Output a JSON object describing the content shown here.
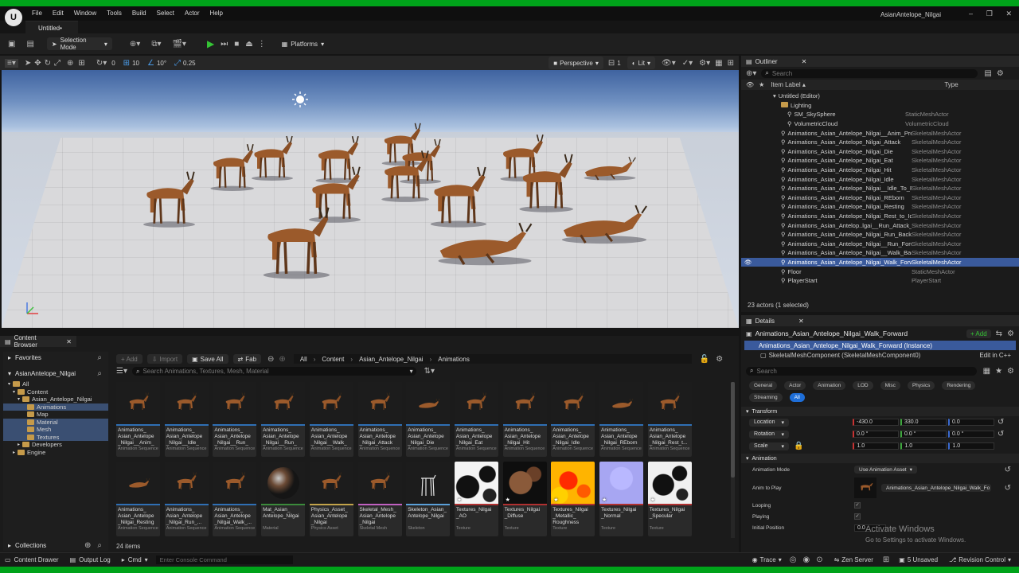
{
  "window": {
    "title": "AsianAntelope_Nilgai",
    "tab": "Untitled•",
    "logo": "U",
    "menu": [
      "File",
      "Edit",
      "Window",
      "Tools",
      "Build",
      "Select",
      "Actor",
      "Help"
    ],
    "controls": [
      "minimize-icon",
      "restore-icon",
      "close-icon"
    ]
  },
  "toolbar": {
    "selection_mode": "Selection Mode",
    "platforms": "Platforms"
  },
  "viewport": {
    "snap_angle": "10°",
    "snap_grid": "10",
    "snap_zero": "0",
    "scale": "0.25",
    "perspective": "Perspective",
    "lit": "Lit",
    "one": "1"
  },
  "outliner": {
    "title": "Outliner",
    "search_placeholder": "Search",
    "col_label": "Item Label ▴",
    "col_type": "Type",
    "items": [
      {
        "label": "Untitled (Editor)",
        "type": "",
        "indent": 0,
        "kind": "level"
      },
      {
        "label": "Lighting",
        "type": "",
        "indent": 1,
        "kind": "folder"
      },
      {
        "label": "SM_SkySphere",
        "type": "StaticMeshActor",
        "indent": 2,
        "kind": "actor"
      },
      {
        "label": "VolumetricCloud",
        "type": "VolumetricCloud",
        "indent": 2,
        "kind": "actor"
      },
      {
        "label": "Animations_Asian_Antelope_Nilgai__Anim_Preview",
        "type": "SkeletalMeshActor",
        "indent": 1,
        "kind": "actor"
      },
      {
        "label": "Animations_Asian_Antelope_Nilgai_Attack",
        "type": "SkeletalMeshActor",
        "indent": 1,
        "kind": "actor"
      },
      {
        "label": "Animations_Asian_Antelope_Nilgai_Die",
        "type": "SkeletalMeshActor",
        "indent": 1,
        "kind": "actor"
      },
      {
        "label": "Animations_Asian_Antelope_Nilgai_Eat",
        "type": "SkeletalMeshActor",
        "indent": 1,
        "kind": "actor"
      },
      {
        "label": "Animations_Asian_Antelope_Nilgai_Hit",
        "type": "SkeletalMeshActor",
        "indent": 1,
        "kind": "actor"
      },
      {
        "label": "Animations_Asian_Antelope_Nilgai_Idle",
        "type": "SkeletalMeshActor",
        "indent": 1,
        "kind": "actor"
      },
      {
        "label": "Animations_Asian_Antelope_Nilgai__Idle_To_Rest",
        "type": "SkeletalMeshActor",
        "indent": 1,
        "kind": "actor"
      },
      {
        "label": "Animations_Asian_Antelope_Nilgai_REborn",
        "type": "SkeletalMeshActor",
        "indent": 1,
        "kind": "actor"
      },
      {
        "label": "Animations_Asian_Antelope_Nilgai_Resting",
        "type": "SkeletalMeshActor",
        "indent": 1,
        "kind": "actor"
      },
      {
        "label": "Animations_Asian_Antelope_Nilgai_Rest_to_Idle",
        "type": "SkeletalMeshActor",
        "indent": 1,
        "kind": "actor"
      },
      {
        "label": "Animations_Asian_Antelop..lgai__Run_Attack_Forward",
        "type": "SkeletalMeshActor",
        "indent": 1,
        "kind": "actor"
      },
      {
        "label": "Animations_Asian_Antelope_Nilgai_Run_Backward",
        "type": "SkeletalMeshActor",
        "indent": 1,
        "kind": "actor"
      },
      {
        "label": "Animations_Asian_Antelope_Nilgai__Run_Forward",
        "type": "SkeletalMeshActor",
        "indent": 1,
        "kind": "actor"
      },
      {
        "label": "Animations_Asian_Antelope_Nilgai__Walk_Backward",
        "type": "SkeletalMeshActor",
        "indent": 1,
        "kind": "actor"
      },
      {
        "label": "Animations_Asian_Antelope_Nilgai_Walk_Forward",
        "type": "SkeletalMeshActor",
        "indent": 1,
        "kind": "actor",
        "selected": true
      },
      {
        "label": "Floor",
        "type": "StaticMeshActor",
        "indent": 1,
        "kind": "actor"
      },
      {
        "label": "PlayerStart",
        "type": "PlayerStart",
        "indent": 1,
        "kind": "actor"
      }
    ],
    "footer": "23 actors (1 selected)"
  },
  "details": {
    "title": "Details",
    "object_name": "Animations_Asian_Antelope_Nilgai_Walk_Forward",
    "add_label": "+ Add",
    "instance": "Animations_Asian_Antelope_Nilgai_Walk_Forward (Instance)",
    "component": "SkeletalMeshComponent (SkeletalMeshComponent0)",
    "edit_cpp": "Edit in C++",
    "search_placeholder": "Search",
    "filters": [
      "General",
      "Actor",
      "Animation",
      "LOD",
      "Misc",
      "Physics",
      "Rendering",
      "Streaming",
      "All"
    ],
    "transform_header": "Transform",
    "location_label": "Location",
    "location": [
      "-430.0",
      "330.0",
      "0.0"
    ],
    "rotation_label": "Rotation",
    "rotation": [
      "0.0 °",
      "0.0 °",
      "0.0 °"
    ],
    "scale_label": "Scale",
    "scale": [
      "1.0",
      "1.0",
      "1.0"
    ],
    "animation_header": "Animation",
    "anim_mode_label": "Animation Mode",
    "anim_mode": "Use Animation Asset",
    "anim_to_play_label": "Anim to Play",
    "anim_to_play": "Animations_Asian_Antelope_Nilgai_Walk_Fo",
    "looping_label": "Looping",
    "playing_label": "Playing",
    "initial_position_label": "Initial Position",
    "initial_position": "0.0"
  },
  "content_browser": {
    "title": "Content Browser",
    "favorites": "Favorites",
    "project": "AsianAntelope_Nilgai",
    "tree": [
      {
        "label": "All",
        "indent": 0
      },
      {
        "label": "Content",
        "indent": 1
      },
      {
        "label": "Asian_Antelope_Nilgai",
        "indent": 2
      },
      {
        "label": "Animations",
        "indent": 3,
        "hl": true
      },
      {
        "label": "Map",
        "indent": 3
      },
      {
        "label": "Material",
        "indent": 3,
        "hl": true
      },
      {
        "label": "Mesh",
        "indent": 3,
        "hl": true
      },
      {
        "label": "Textures",
        "indent": 3,
        "hl": true
      },
      {
        "label": "Developers",
        "indent": 2
      },
      {
        "label": "Engine",
        "indent": 1
      }
    ],
    "collections": "Collections",
    "add_label": "+ Add",
    "import_label": "Import",
    "save_all_label": "Save All",
    "fab_label": "Fab",
    "path": [
      "All",
      "Content",
      "Asian_Antelope_Nilgai",
      "Animations"
    ],
    "search_placeholder": "Search Animations, Textures, Mesh, Material",
    "item_count": "24 items",
    "assets": [
      {
        "name": "Animations_ Asian_Antelope _Nilgai__Anim_",
        "type": "Animation Sequence",
        "thumb": "antelope",
        "bar": "#2f6fb4"
      },
      {
        "name": "Animations_ Asian_Antelope _Nilgai__Idle_",
        "type": "Animation Sequence",
        "thumb": "antelope",
        "bar": "#2f6fb4"
      },
      {
        "name": "Animations_ Asian_Antelope _Nilgai__Run_",
        "type": "Animation Sequence",
        "thumb": "antelope",
        "bar": "#2f6fb4"
      },
      {
        "name": "Animations_ Asian_Antelope _Nilgai__Run_",
        "type": "Animation Sequence",
        "thumb": "antelope",
        "bar": "#2f6fb4"
      },
      {
        "name": "Animations_ Asian_Antelope _Nilgai__Walk_",
        "type": "Animation Sequence",
        "thumb": "antelope",
        "bar": "#2f6fb4"
      },
      {
        "name": "Animations_ Asian_Antelope _Nilgai_Attack",
        "type": "Animation Sequence",
        "thumb": "antelope",
        "bar": "#2f6fb4"
      },
      {
        "name": "Animations_ Asian_Antelope _Nilgai_Die",
        "type": "Animation Sequence",
        "thumb": "lying",
        "bar": "#2f6fb4"
      },
      {
        "name": "Animations_ Asian_Antelope _Nilgai_Eat",
        "type": "Animation Sequence",
        "thumb": "antelope",
        "bar": "#2f6fb4"
      },
      {
        "name": "Animations_ Asian_Antelope _Nilgai_Hit",
        "type": "Animation Sequence",
        "thumb": "antelope",
        "bar": "#2f6fb4"
      },
      {
        "name": "Animations_ Asian_Antelope _Nilgai_Idle",
        "type": "Animation Sequence",
        "thumb": "antelope",
        "bar": "#2f6fb4"
      },
      {
        "name": "Animations_ Asian_Antelope _Nilgai_REborn",
        "type": "Animation Sequence",
        "thumb": "lying",
        "bar": "#2f6fb4"
      },
      {
        "name": "Animations_ Asian_Antelope _Nilgai_Rest_t...",
        "type": "Animation Sequence",
        "thumb": "antelope",
        "bar": "#2f6fb4"
      },
      {
        "name": "Animations_ Asian_Antelope _Nilgai_Resting",
        "type": "Animation Sequence",
        "thumb": "lying",
        "bar": "#2f6fb4"
      },
      {
        "name": "Animations_ Asian_Antelope _Nilgai_Run_...",
        "type": "Animation Sequence",
        "thumb": "antelope",
        "bar": "#2f6fb4"
      },
      {
        "name": "Animations_ Asian_Antelope _Nilgai_Walk_...",
        "type": "Animation Sequence",
        "thumb": "antelope",
        "bar": "#2f6fb4"
      },
      {
        "name": "Mat_Asian_ Antelope_Nilgai",
        "type": "Material",
        "thumb": "sphere",
        "bar": "#3b8a3b"
      },
      {
        "name": "Physics_Asset_ Asian_Antelope _Nilgai",
        "type": "Physics Asset",
        "thumb": "antelope",
        "bar": "#c2a34a"
      },
      {
        "name": "Skeletal_Mesh_ Asian_Antelope _Nilgai",
        "type": "Skeletal Mesh",
        "thumb": "antelope",
        "bar": "#c060c0"
      },
      {
        "name": "Skeleton_Asian_ Antelope_Nilgai",
        "type": "Skeleton",
        "thumb": "skeleton",
        "bar": "#5aa0d8"
      },
      {
        "name": "Textures_Nilgai _AO",
        "type": "Texture",
        "thumb": "tex-ao",
        "bar": "#b03030"
      },
      {
        "name": "Textures_Nilgai _Diffuse",
        "type": "Texture",
        "thumb": "tex-diffuse",
        "bar": "#b03030"
      },
      {
        "name": "Textures_Nilgai _Metallic_ Roughness",
        "type": "Texture",
        "thumb": "tex-metal",
        "bar": "#b03030"
      },
      {
        "name": "Textures_Nilgai _Normal",
        "type": "Texture",
        "thumb": "tex-normal",
        "bar": "#b03030"
      },
      {
        "name": "Textures_Nilgai _Specular",
        "type": "Texture",
        "thumb": "tex-spec",
        "bar": "#b03030"
      }
    ]
  },
  "statusbar": {
    "content_drawer": "Content Drawer",
    "output_log": "Output Log",
    "cmd": "Cmd",
    "console_placeholder": "Enter Console Command",
    "trace": "Trace",
    "zen_server": "Zen Server",
    "unsaved": "5 Unsaved",
    "revision_control": "Revision Control"
  },
  "watermark": {
    "title": "Activate Windows",
    "subtitle": "Go to Settings to activate Windows."
  }
}
